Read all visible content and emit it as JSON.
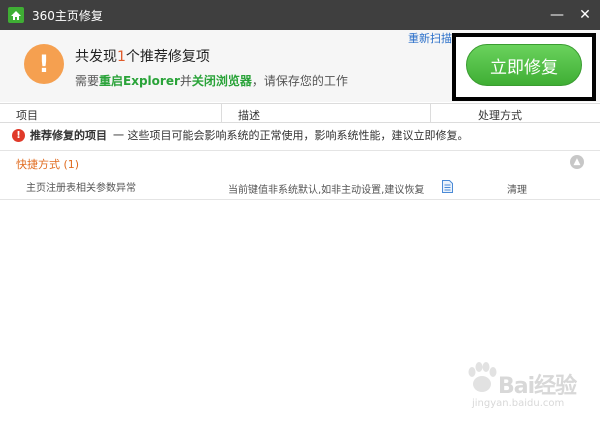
{
  "window": {
    "title": "360主页修复",
    "minimize": "—",
    "close": "✕"
  },
  "header": {
    "found_prefix": "共发现",
    "found_count": "1",
    "found_suffix": "个推荐修复项",
    "hint_prefix": "需要",
    "hint_restart": "重启Explorer",
    "hint_and": "并",
    "hint_close": "关闭浏览器",
    "hint_suffix": "，请保存您的工作",
    "rescan_label": "重新扫描",
    "fix_button_label": "立即修复"
  },
  "columns": {
    "item": "项目",
    "desc": "描述",
    "action": "处理方式"
  },
  "recommended": {
    "title": "推荐修复的项目",
    "desc": "一 这些项目可能会影响系统的正常使用，影响系统性能，建议立即修复。"
  },
  "group": {
    "label": "快捷方式 (1)"
  },
  "items": [
    {
      "name": "主页注册表相关参数异常",
      "desc": "当前键值非系统默认,如非主动设置,建议恢复",
      "action": "清理"
    }
  ],
  "watermark": {
    "text": "Bai经验",
    "url": "jingyan.baidu.com"
  },
  "colors": {
    "titlebar": "#3f3f3f",
    "accent_green": "#3fae34",
    "warn_orange": "#f5a050",
    "link_blue": "#2a6fc9",
    "error_red": "#e03a2a"
  }
}
